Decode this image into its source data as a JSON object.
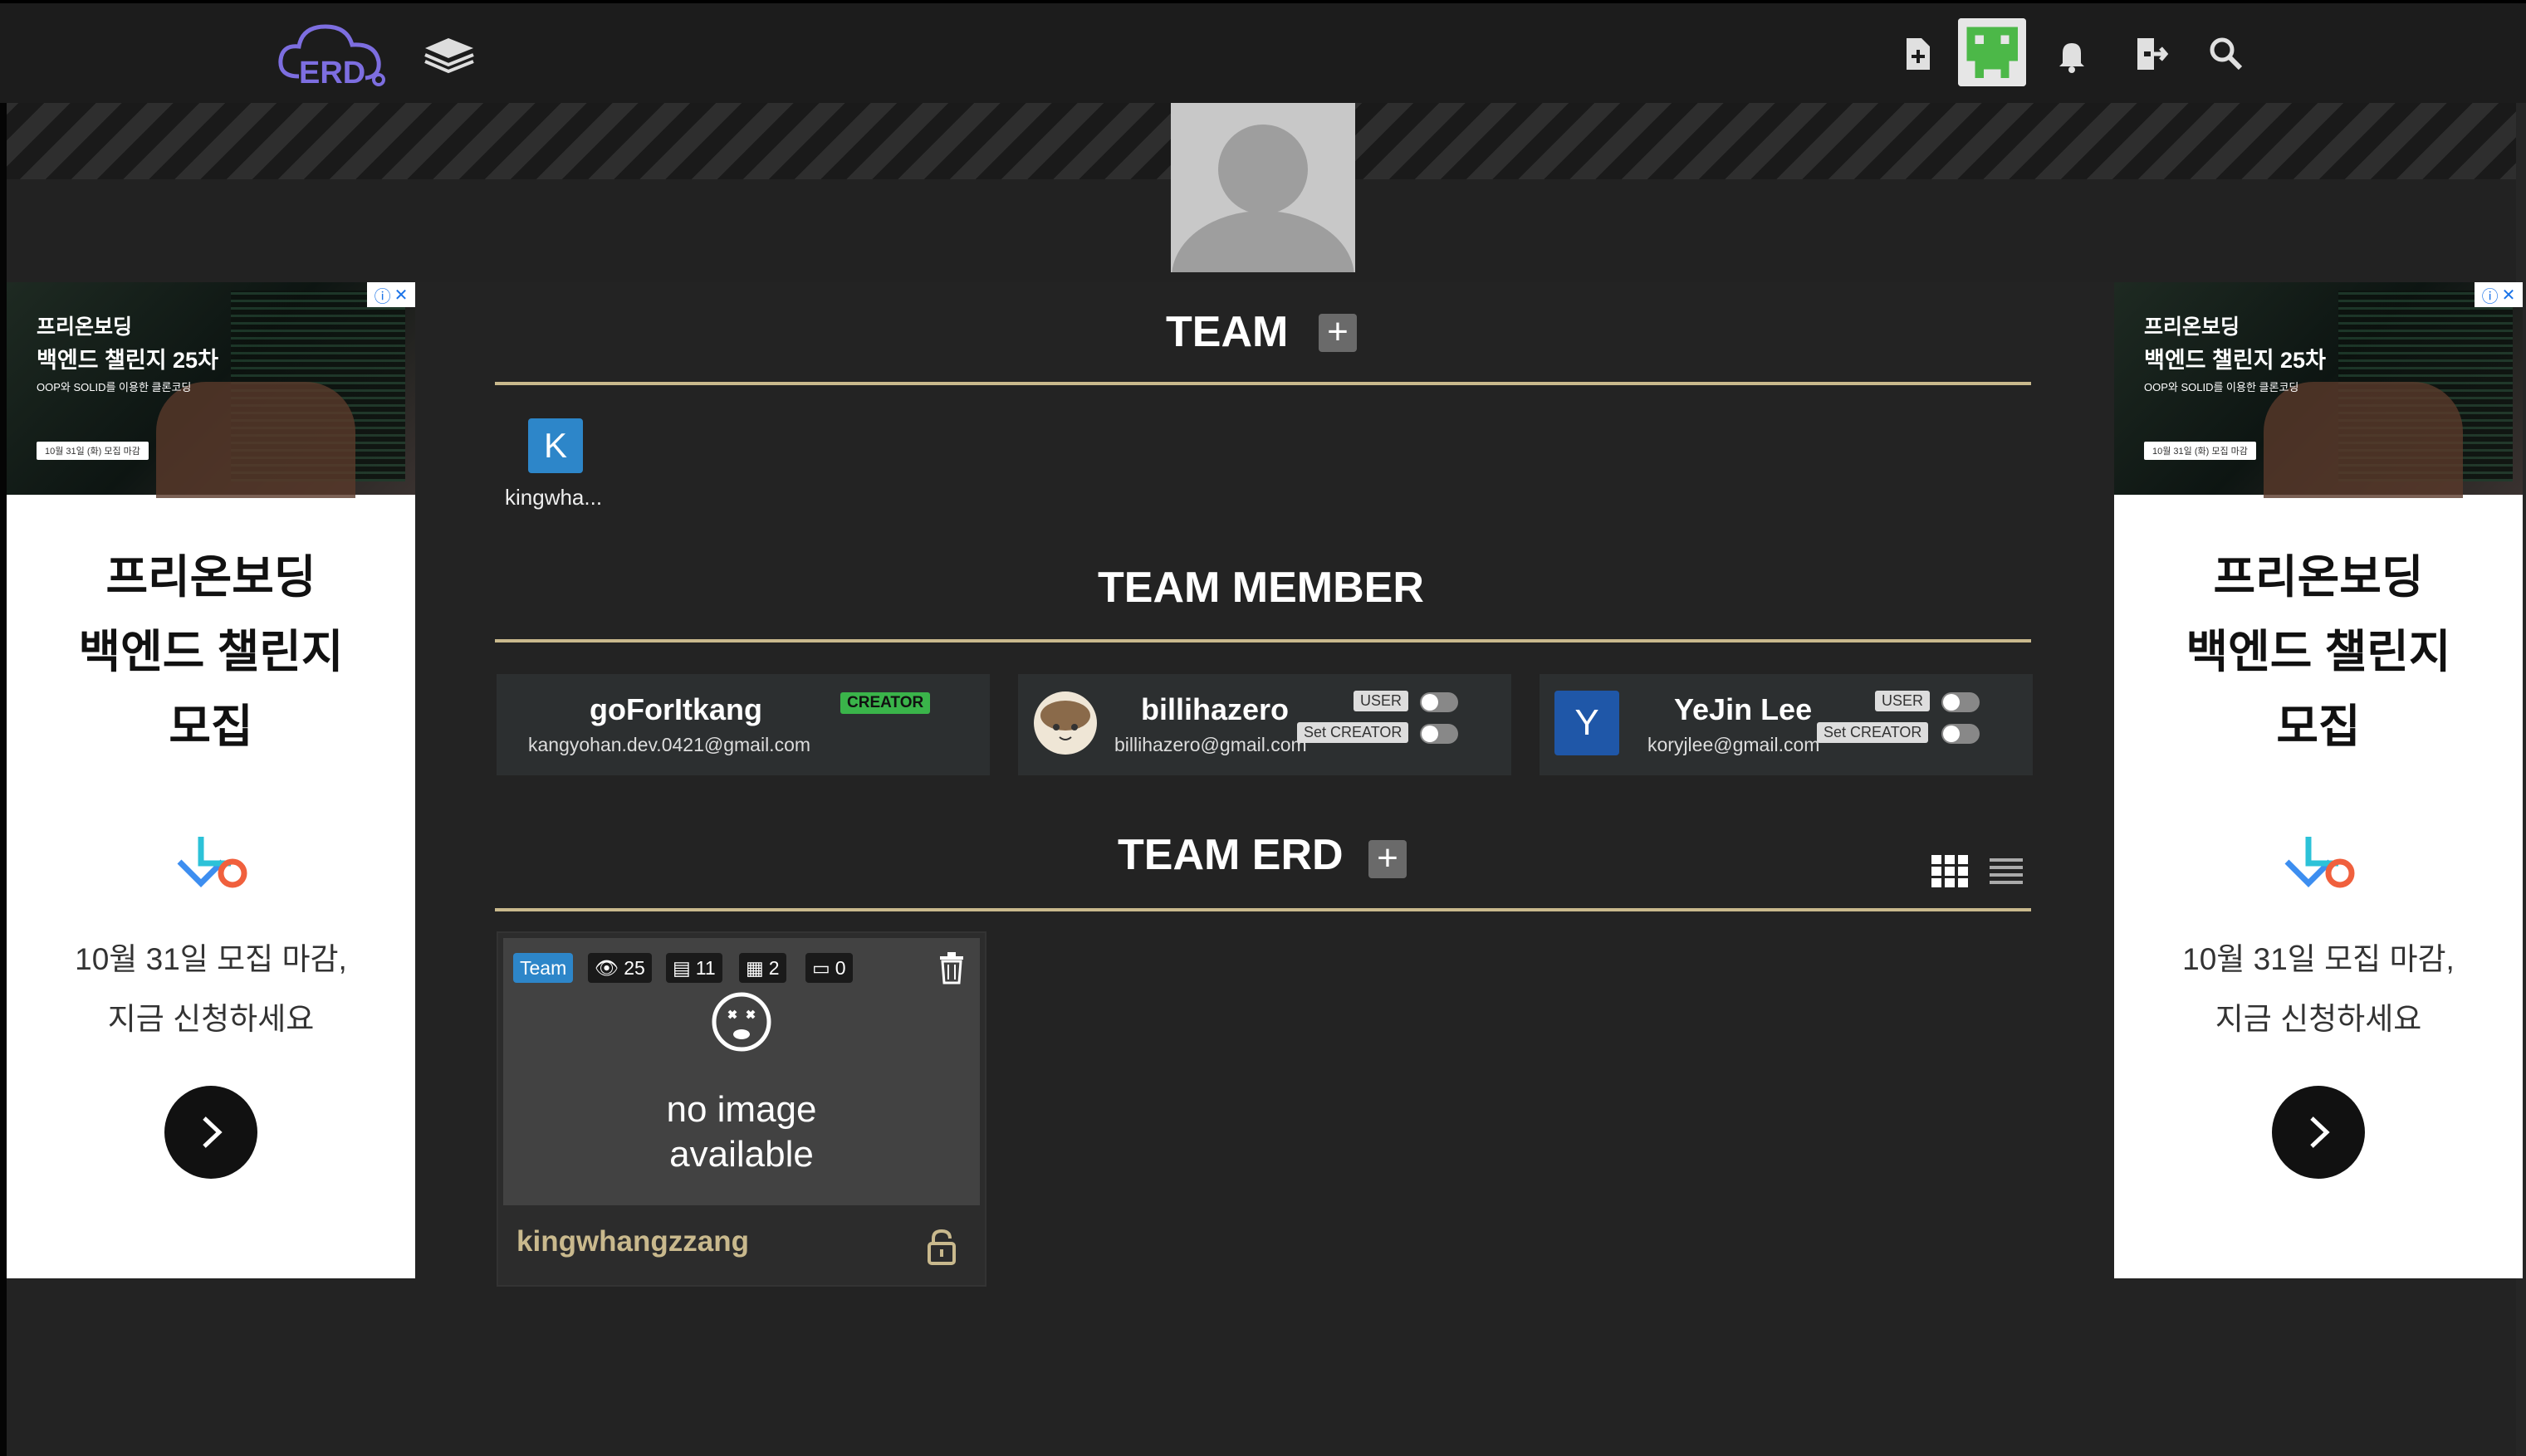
{
  "header": {
    "logo_text": "ERD",
    "icons": [
      "logo-cloud-icon",
      "layers-icon",
      "new-file-icon",
      "user-avatar",
      "bell-icon",
      "logout-icon",
      "search-icon"
    ]
  },
  "ads": {
    "left": {
      "photo_title_line1": "프리온보딩",
      "photo_title_line2": "백엔드 챌린지 25차",
      "photo_desc": "OOP와 SOLID를 이용한 클론코딩",
      "photo_tag": "10월 31일 (화) 모집 마감",
      "headline_line1": "프리온보딩",
      "headline_line2": "백엔드 챌린지",
      "headline_line3": "모집",
      "sub_line1": "10월 31일 모집 마감,",
      "sub_line2": "지금 신청하세요"
    },
    "right": {
      "photo_title_line1": "프리온보딩",
      "photo_title_line2": "백엔드 챌린지 25차",
      "photo_desc": "OOP와 SOLID를 이용한 클론코딩",
      "photo_tag": "10월 31일 (화) 모집 마감",
      "headline_line1": "프리온보딩",
      "headline_line2": "백엔드 챌린지",
      "headline_line3": "모집",
      "sub_line1": "10월 31일 모집 마감,",
      "sub_line2": "지금 신청하세요"
    }
  },
  "team": {
    "title": "TEAM",
    "add_label": "+",
    "items": [
      {
        "initial": "K",
        "label": "kingwha..."
      }
    ]
  },
  "members": {
    "title": "TEAM MEMBER",
    "list": [
      {
        "name": "goForItkang",
        "email": "kangyohan.dev.0421@gmail.com",
        "role": "CREATOR"
      },
      {
        "name": "billihazero",
        "email": "billihazero@gmail.com",
        "role": "USER",
        "set_label": "Set CREATOR"
      },
      {
        "name": "YeJin Lee",
        "initial": "Y",
        "email": "koryjlee@gmail.com",
        "role": "USER",
        "set_label": "Set CREATOR"
      }
    ]
  },
  "erd": {
    "title": "TEAM ERD",
    "add_label": "+",
    "cards": [
      {
        "badge": "Team",
        "views": "25",
        "tables": "11",
        "members": "2",
        "comments": "0",
        "no_image_line1": "no image",
        "no_image_line2": "available",
        "name": "kingwhangzzang"
      }
    ]
  },
  "colors": {
    "accent_gold": "#c9b98d",
    "brand_blue": "#2d86c9",
    "creator_green": "#3ab44a",
    "bg": "#232323"
  }
}
